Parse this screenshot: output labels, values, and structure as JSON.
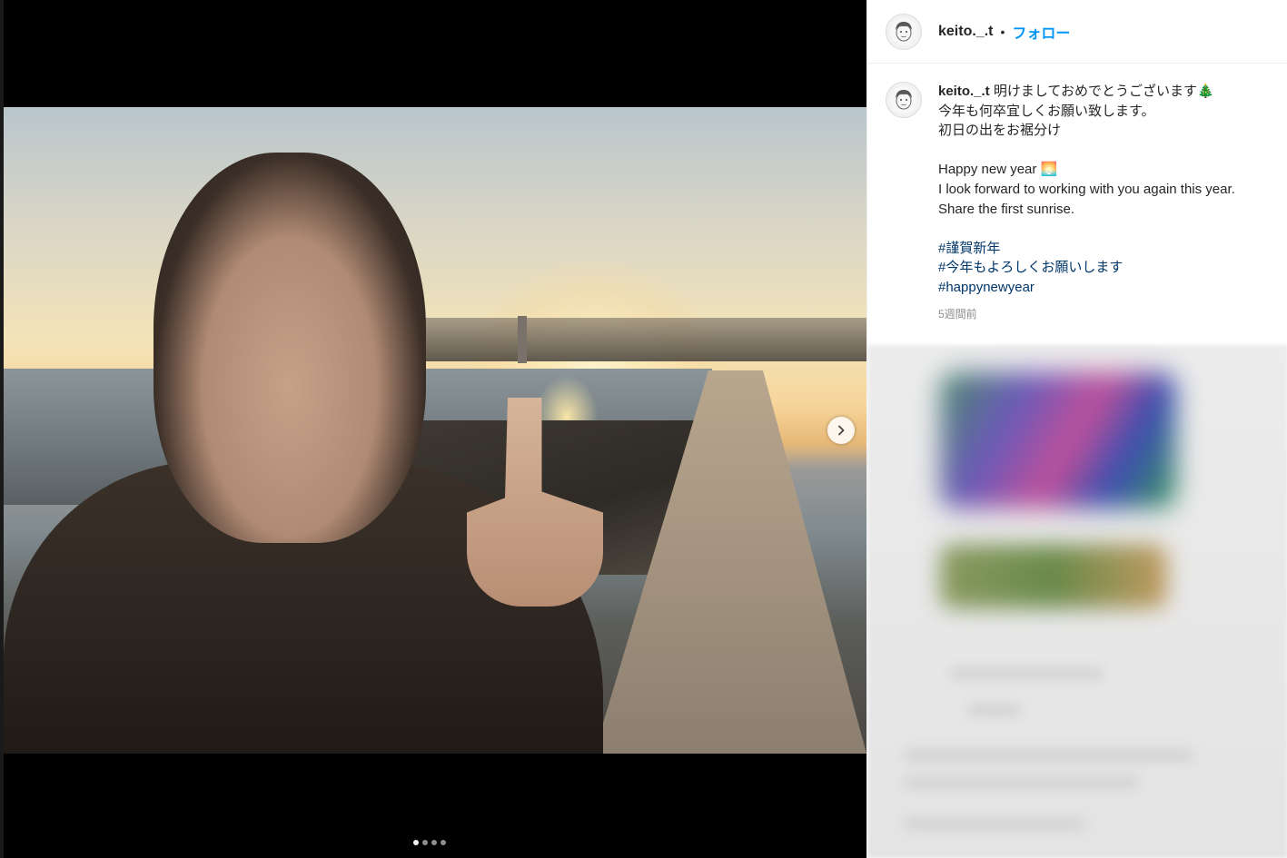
{
  "post": {
    "username": "keito._.t",
    "separator": "•",
    "follow_label": "フォロー",
    "caption": {
      "lines": [
        "明けましておめでとうございます🎄",
        "今年も何卒宜しくお願い致します。",
        "初日の出をお裾分け"
      ],
      "english_lines": [
        "Happy new year 🌅",
        "I look forward to working with you again this year.",
        "Share the first sunrise."
      ],
      "hashtags": [
        "#謹賀新年",
        "#今年もよろしくお願いします",
        "#happynewyear"
      ]
    },
    "timestamp": "5週間前"
  },
  "carousel": {
    "slide_count": 4,
    "current_slide": 1
  },
  "icons": {
    "next": "chevron-right-icon",
    "avatar": "avatar-illustration-icon"
  },
  "colors": {
    "follow_blue": "#0095f6",
    "hashtag_blue": "#00376b",
    "text": "#262626",
    "muted": "#8e8e8e"
  }
}
